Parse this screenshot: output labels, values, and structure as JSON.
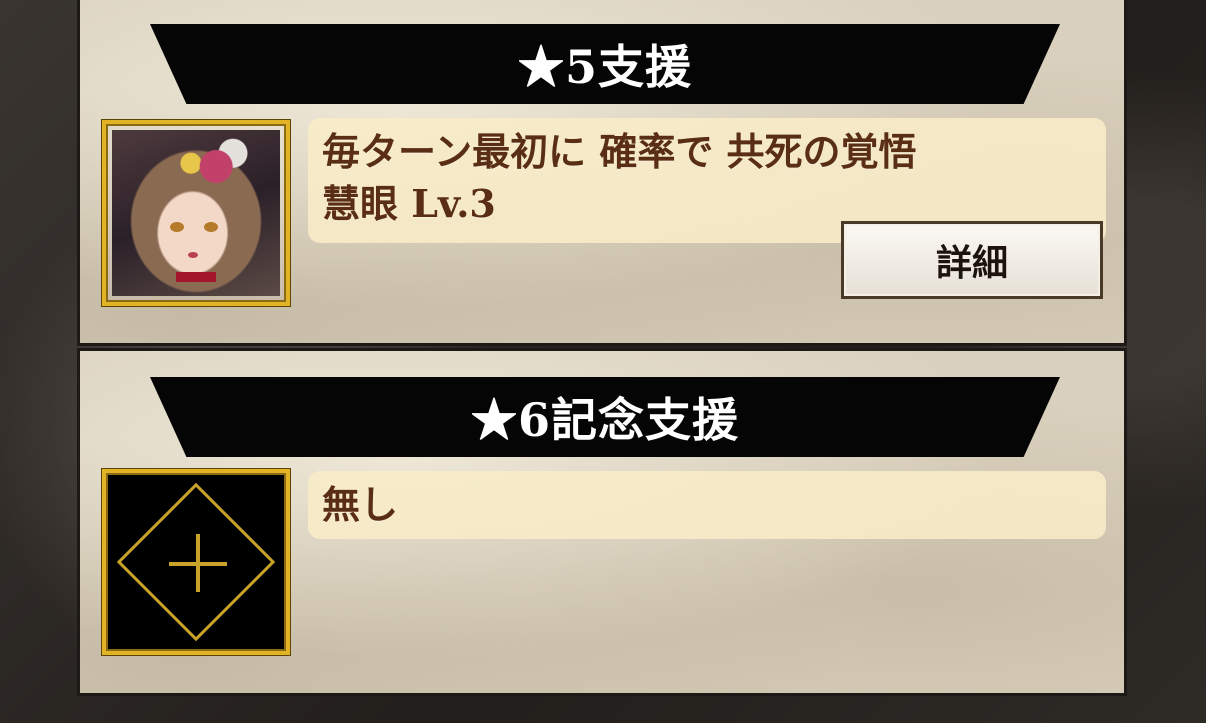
{
  "support5": {
    "title": "★5支援",
    "lines": [
      "毎ターン最初に 確率で 共死の覚悟",
      "慧眼 Lv.3"
    ],
    "detail_label": "詳細",
    "portrait": "character-portrait"
  },
  "support6": {
    "title": "★6記念支援",
    "empty_text": "無し",
    "icon": "plus-icon"
  },
  "colors": {
    "banner": "#050505",
    "gold_frame": "#e2b325",
    "text_brown": "#5a2e14"
  }
}
